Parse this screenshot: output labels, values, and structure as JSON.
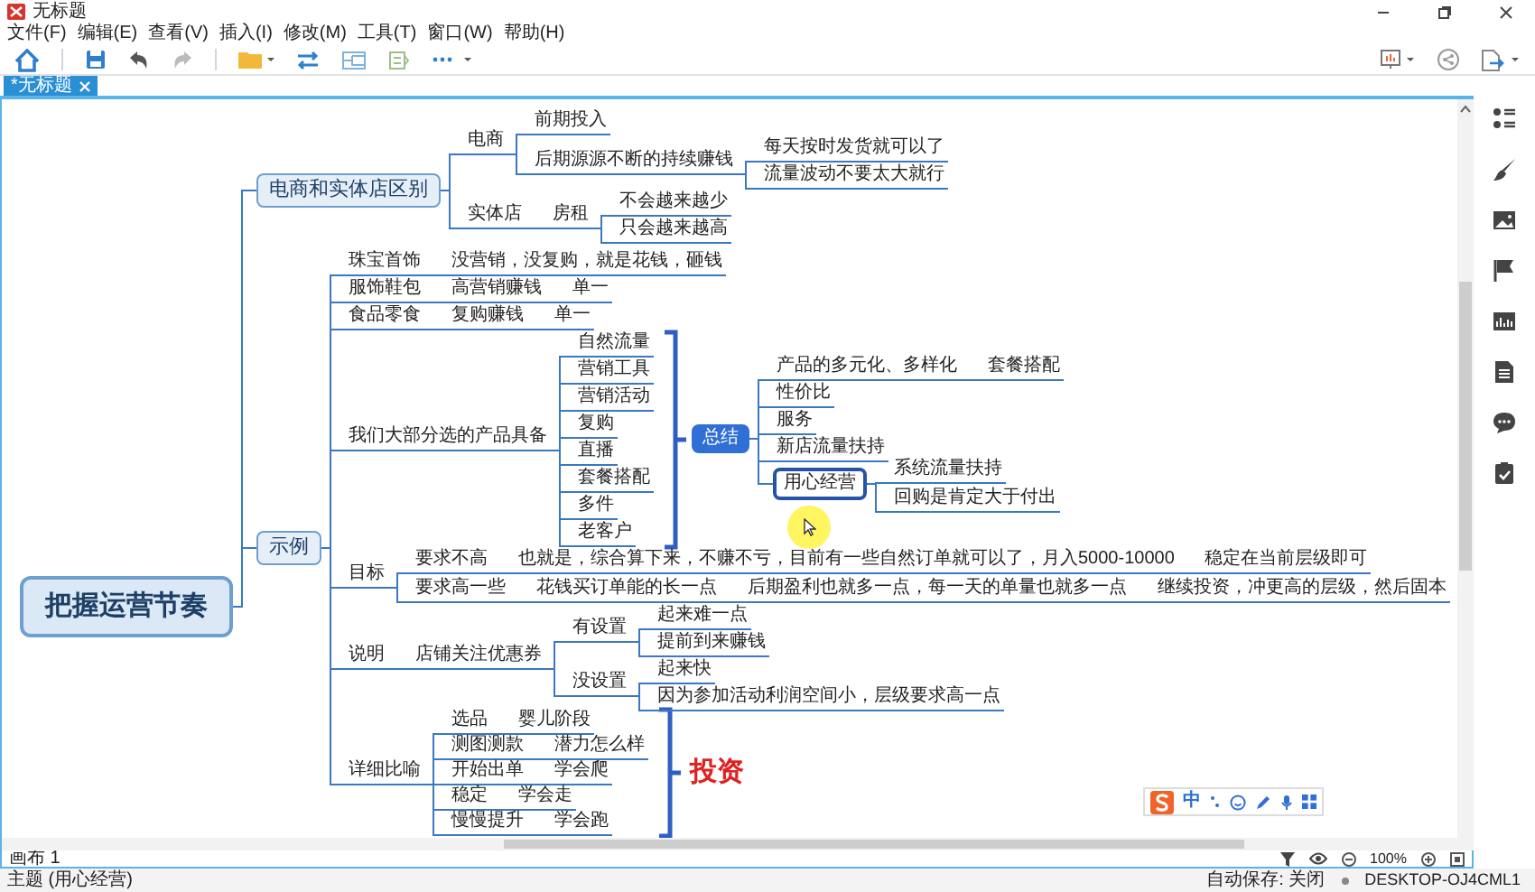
{
  "window": {
    "title": "无标题"
  },
  "menu": [
    "文件(F)",
    "编辑(E)",
    "查看(V)",
    "插入(I)",
    "修改(M)",
    "工具(T)",
    "窗口(W)",
    "帮助(H)"
  ],
  "tabs": [
    {
      "label": "*无标题",
      "selected": true
    }
  ],
  "mindmap": {
    "label": "把握运营节奏",
    "selected": false,
    "children": [
      {
        "label": "电商和实体店区别",
        "selected": false,
        "children": [
          {
            "label": "电商",
            "selected": false,
            "children": [
              {
                "label": "前期投入",
                "selected": false
              },
              {
                "label": "后期源源不断的持续赚钱",
                "selected": false,
                "children": [
                  {
                    "label": "每天按时发货就可以了",
                    "selected": false
                  },
                  {
                    "label": "流量波动不要太大就行",
                    "selected": false
                  }
                ]
              }
            ]
          },
          {
            "label": "实体店",
            "selected": false,
            "children": [
              {
                "label": "房租",
                "selected": false,
                "children": [
                  {
                    "label": "不会越来越少",
                    "selected": false
                  },
                  {
                    "label": "只会越来越高",
                    "selected": false
                  }
                ]
              }
            ]
          }
        ]
      },
      {
        "label": "示例",
        "selected": false,
        "children": [
          {
            "label": "珠宝首饰",
            "selected": false,
            "children": [
              {
                "label": "没营销，没复购，就是花钱，砸钱",
                "selected": false
              }
            ]
          },
          {
            "label": "服饰鞋包",
            "selected": false,
            "children": [
              {
                "label": "高营销赚钱",
                "selected": false,
                "children": [
                  {
                    "label": "单一",
                    "selected": false
                  }
                ]
              }
            ]
          },
          {
            "label": "食品零食",
            "selected": false,
            "children": [
              {
                "label": "复购赚钱",
                "selected": false,
                "children": [
                  {
                    "label": "单一",
                    "selected": false
                  }
                ]
              }
            ]
          },
          {
            "label": "我们大部分选的产品具备",
            "selected": false,
            "children": [
              {
                "label": "自然流量",
                "selected": false
              },
              {
                "label": "营销工具",
                "selected": false
              },
              {
                "label": "营销活动",
                "selected": false
              },
              {
                "label": "复购",
                "selected": false
              },
              {
                "label": "直播",
                "selected": false
              },
              {
                "label": "套餐搭配",
                "selected": false
              },
              {
                "label": "多件",
                "selected": false
              },
              {
                "label": "老客户",
                "selected": false
              }
            ],
            "summary": {
              "label": "总结",
              "kind": "summary",
              "selected": false,
              "children": [
                {
                  "label": "产品的多元化、多样化",
                  "selected": false,
                  "children": [
                    {
                      "label": "套餐搭配",
                      "selected": false
                    }
                  ]
                },
                {
                  "label": "性价比",
                  "selected": false
                },
                {
                  "label": "服务",
                  "selected": false
                },
                {
                  "label": "新店流量扶持",
                  "selected": false
                },
                {
                  "label": "用心经营",
                  "selected": true,
                  "children": [
                    {
                      "label": "系统流量扶持",
                      "selected": false
                    },
                    {
                      "label": "回购是肯定大于付出",
                      "selected": false
                    }
                  ]
                }
              ]
            }
          },
          {
            "label": "目标",
            "selected": false,
            "children": [
              {
                "label": "要求不高",
                "selected": false,
                "children": [
                  {
                    "label": "也就是，综合算下来，不赚不亏，目前有一些自然订单就可以了，月入5000-10000",
                    "selected": false,
                    "children": [
                      {
                        "label": "稳定在当前层级即可",
                        "selected": false
                      }
                    ]
                  }
                ]
              },
              {
                "label": "要求高一些",
                "selected": false,
                "children": [
                  {
                    "label": "花钱买订单能的长一点",
                    "selected": false,
                    "children": [
                      {
                        "label": "后期盈利也就多一点，每一天的单量也就多一点",
                        "selected": false,
                        "children": [
                          {
                            "label": "继续投资，冲更高的层级，然后固本",
                            "selected": false
                          }
                        ]
                      }
                    ]
                  }
                ]
              }
            ]
          },
          {
            "label": "说明",
            "selected": false,
            "children": [
              {
                "label": "店铺关注优惠券",
                "selected": false,
                "children": [
                  {
                    "label": "有设置",
                    "selected": false,
                    "children": [
                      {
                        "label": "起来难一点",
                        "selected": false
                      },
                      {
                        "label": "提前到来赚钱",
                        "selected": false
                      }
                    ]
                  },
                  {
                    "label": "没设置",
                    "selected": false,
                    "children": [
                      {
                        "label": "起来快",
                        "selected": false
                      },
                      {
                        "label": "因为参加活动利润空间小，层级要求高一点",
                        "selected": false
                      }
                    ]
                  }
                ]
              }
            ]
          },
          {
            "label": "详细比喻",
            "selected": false,
            "children": [
              {
                "label": "选品",
                "selected": false,
                "children": [
                  {
                    "label": "婴儿阶段",
                    "selected": false
                  }
                ]
              },
              {
                "label": "测图测款",
                "selected": false,
                "children": [
                  {
                    "label": "潜力怎么样",
                    "selected": false
                  }
                ]
              },
              {
                "label": "开始出单",
                "selected": false,
                "children": [
                  {
                    "label": "学会爬",
                    "selected": false
                  }
                ]
              },
              {
                "label": "稳定",
                "selected": false,
                "children": [
                  {
                    "label": "学会走",
                    "selected": false
                  }
                ]
              },
              {
                "label": "慢慢提升",
                "selected": false,
                "children": [
                  {
                    "label": "学会跑",
                    "selected": false
                  }
                ]
              }
            ],
            "summary": {
              "label": "投资",
              "kind": "emphasis",
              "selected": false
            }
          }
        ]
      }
    ]
  },
  "ime": {
    "mode": "中"
  },
  "canvas_bar": {
    "sheet": "画布 1",
    "zoom": "100%"
  },
  "status_bar": {
    "topic": "主题 (用心经营)",
    "autosave": "自动保存: 关闭",
    "computer": "DESKTOP-OJ4CML1"
  }
}
